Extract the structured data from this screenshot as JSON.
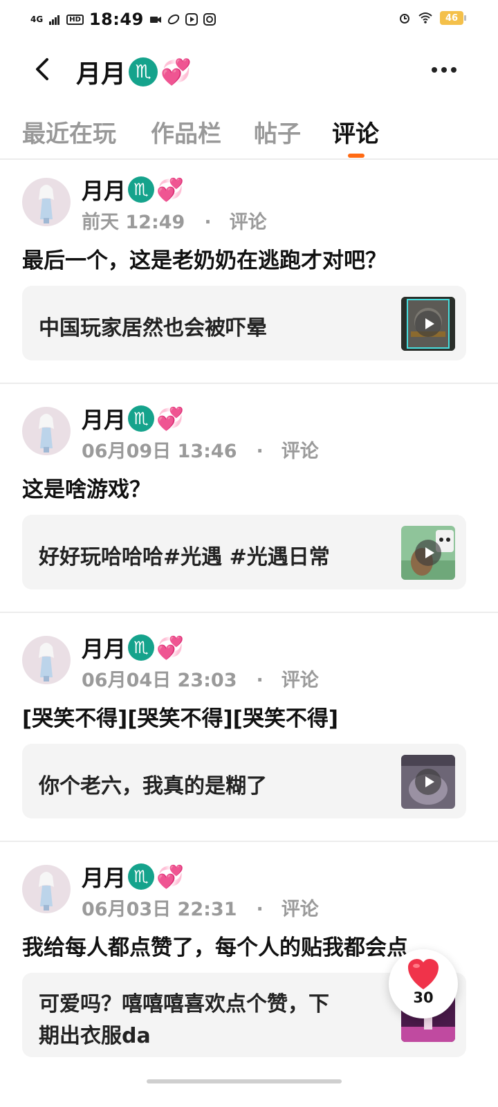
{
  "status_bar": {
    "network": "4G",
    "hd": "HD",
    "time": "18:49",
    "battery": "46"
  },
  "header": {
    "title": "月月",
    "zodiac": "♏",
    "heart": "💞"
  },
  "tabs": [
    "最近在玩",
    "作品栏",
    "帖子",
    "评论"
  ],
  "active_tab": "评论",
  "comments": [
    {
      "author": "月月",
      "date": "前天 12:49",
      "type": "评论",
      "text": "最后一个，这是老奶奶在逃跑才对吧？",
      "quote": "中国玩家居然也会被吓晕"
    },
    {
      "author": "月月",
      "date": "06月09日 13:46",
      "type": "评论",
      "text": "这是啥游戏？",
      "quote": "好好玩哈哈哈#光遇 #光遇日常"
    },
    {
      "author": "月月",
      "date": "06月04日 23:03",
      "type": "评论",
      "text": "[哭笑不得][哭笑不得][哭笑不得]",
      "quote": "你个老六，我真的是糊了"
    },
    {
      "author": "月月",
      "date": "06月03日 22:31",
      "type": "评论",
      "text": "我给每人都点赞了，每个人的贴我都会点",
      "quote_line1": "可爱吗？嘻嘻嘻喜欢点个赞，下",
      "quote_line2": "期出衣服da"
    }
  ],
  "like": {
    "count": "30"
  },
  "colors": {
    "accent": "#ff6a13",
    "zodiac_bg": "#15a38c",
    "like_heart": "#f0334a"
  }
}
